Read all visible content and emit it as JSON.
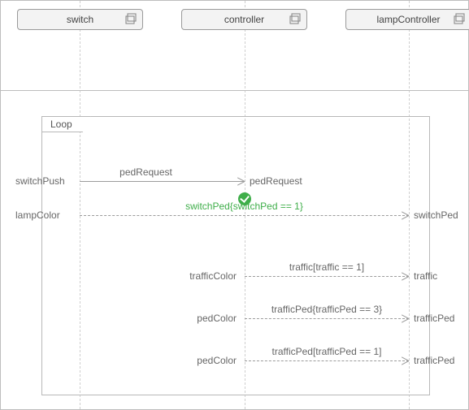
{
  "lifelines": {
    "a": "switch",
    "b": "controller",
    "c": "lampController"
  },
  "fragment": {
    "kind": "Loop"
  },
  "gates": {
    "m1_left": "switchPush",
    "m1_right": "pedRequest",
    "m2_left": "lampColor",
    "m2_right": "switchPed",
    "m3_left": "trafficColor",
    "m3_right": "traffic",
    "m4_left": "pedColor",
    "m4_right": "trafficPed",
    "m5_left": "pedColor",
    "m5_right": "trafficPed"
  },
  "messages": {
    "m1": "pedRequest",
    "m2": "switchPed{switchPed == 1}",
    "m3": "traffic[traffic == 1]",
    "m4": "trafficPed{trafficPed == 3}",
    "m5": "trafficPed[trafficPed == 1]"
  }
}
